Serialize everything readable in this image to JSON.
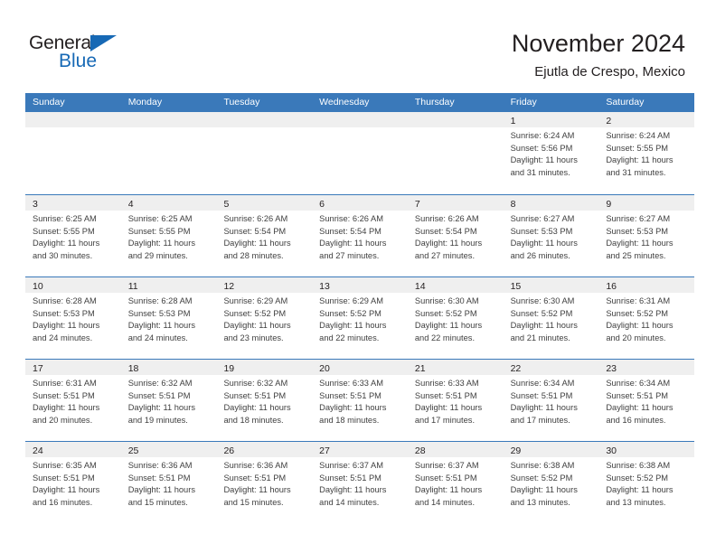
{
  "brand": {
    "word_one": "General",
    "word_two": "Blue",
    "accent_color": "#1769b5",
    "triangle_icon": "triangle-icon"
  },
  "header": {
    "title": "November 2024",
    "subtitle": "Ejutla de Crespo, Mexico"
  },
  "theme": {
    "header_blue": "#3a79ba",
    "daynum_band": "#efefef",
    "text": "#231f20",
    "body_text": "#3f3f3f"
  },
  "weekday_headers": [
    "Sunday",
    "Monday",
    "Tuesday",
    "Wednesday",
    "Thursday",
    "Friday",
    "Saturday"
  ],
  "weeks": [
    [
      {
        "day": "",
        "lines": []
      },
      {
        "day": "",
        "lines": []
      },
      {
        "day": "",
        "lines": []
      },
      {
        "day": "",
        "lines": []
      },
      {
        "day": "",
        "lines": []
      },
      {
        "day": "1",
        "lines": [
          "Sunrise: 6:24 AM",
          "Sunset: 5:56 PM",
          "Daylight: 11 hours",
          "and 31 minutes."
        ]
      },
      {
        "day": "2",
        "lines": [
          "Sunrise: 6:24 AM",
          "Sunset: 5:55 PM",
          "Daylight: 11 hours",
          "and 31 minutes."
        ]
      }
    ],
    [
      {
        "day": "3",
        "lines": [
          "Sunrise: 6:25 AM",
          "Sunset: 5:55 PM",
          "Daylight: 11 hours",
          "and 30 minutes."
        ]
      },
      {
        "day": "4",
        "lines": [
          "Sunrise: 6:25 AM",
          "Sunset: 5:55 PM",
          "Daylight: 11 hours",
          "and 29 minutes."
        ]
      },
      {
        "day": "5",
        "lines": [
          "Sunrise: 6:26 AM",
          "Sunset: 5:54 PM",
          "Daylight: 11 hours",
          "and 28 minutes."
        ]
      },
      {
        "day": "6",
        "lines": [
          "Sunrise: 6:26 AM",
          "Sunset: 5:54 PM",
          "Daylight: 11 hours",
          "and 27 minutes."
        ]
      },
      {
        "day": "7",
        "lines": [
          "Sunrise: 6:26 AM",
          "Sunset: 5:54 PM",
          "Daylight: 11 hours",
          "and 27 minutes."
        ]
      },
      {
        "day": "8",
        "lines": [
          "Sunrise: 6:27 AM",
          "Sunset: 5:53 PM",
          "Daylight: 11 hours",
          "and 26 minutes."
        ]
      },
      {
        "day": "9",
        "lines": [
          "Sunrise: 6:27 AM",
          "Sunset: 5:53 PM",
          "Daylight: 11 hours",
          "and 25 minutes."
        ]
      }
    ],
    [
      {
        "day": "10",
        "lines": [
          "Sunrise: 6:28 AM",
          "Sunset: 5:53 PM",
          "Daylight: 11 hours",
          "and 24 minutes."
        ]
      },
      {
        "day": "11",
        "lines": [
          "Sunrise: 6:28 AM",
          "Sunset: 5:53 PM",
          "Daylight: 11 hours",
          "and 24 minutes."
        ]
      },
      {
        "day": "12",
        "lines": [
          "Sunrise: 6:29 AM",
          "Sunset: 5:52 PM",
          "Daylight: 11 hours",
          "and 23 minutes."
        ]
      },
      {
        "day": "13",
        "lines": [
          "Sunrise: 6:29 AM",
          "Sunset: 5:52 PM",
          "Daylight: 11 hours",
          "and 22 minutes."
        ]
      },
      {
        "day": "14",
        "lines": [
          "Sunrise: 6:30 AM",
          "Sunset: 5:52 PM",
          "Daylight: 11 hours",
          "and 22 minutes."
        ]
      },
      {
        "day": "15",
        "lines": [
          "Sunrise: 6:30 AM",
          "Sunset: 5:52 PM",
          "Daylight: 11 hours",
          "and 21 minutes."
        ]
      },
      {
        "day": "16",
        "lines": [
          "Sunrise: 6:31 AM",
          "Sunset: 5:52 PM",
          "Daylight: 11 hours",
          "and 20 minutes."
        ]
      }
    ],
    [
      {
        "day": "17",
        "lines": [
          "Sunrise: 6:31 AM",
          "Sunset: 5:51 PM",
          "Daylight: 11 hours",
          "and 20 minutes."
        ]
      },
      {
        "day": "18",
        "lines": [
          "Sunrise: 6:32 AM",
          "Sunset: 5:51 PM",
          "Daylight: 11 hours",
          "and 19 minutes."
        ]
      },
      {
        "day": "19",
        "lines": [
          "Sunrise: 6:32 AM",
          "Sunset: 5:51 PM",
          "Daylight: 11 hours",
          "and 18 minutes."
        ]
      },
      {
        "day": "20",
        "lines": [
          "Sunrise: 6:33 AM",
          "Sunset: 5:51 PM",
          "Daylight: 11 hours",
          "and 18 minutes."
        ]
      },
      {
        "day": "21",
        "lines": [
          "Sunrise: 6:33 AM",
          "Sunset: 5:51 PM",
          "Daylight: 11 hours",
          "and 17 minutes."
        ]
      },
      {
        "day": "22",
        "lines": [
          "Sunrise: 6:34 AM",
          "Sunset: 5:51 PM",
          "Daylight: 11 hours",
          "and 17 minutes."
        ]
      },
      {
        "day": "23",
        "lines": [
          "Sunrise: 6:34 AM",
          "Sunset: 5:51 PM",
          "Daylight: 11 hours",
          "and 16 minutes."
        ]
      }
    ],
    [
      {
        "day": "24",
        "lines": [
          "Sunrise: 6:35 AM",
          "Sunset: 5:51 PM",
          "Daylight: 11 hours",
          "and 16 minutes."
        ]
      },
      {
        "day": "25",
        "lines": [
          "Sunrise: 6:36 AM",
          "Sunset: 5:51 PM",
          "Daylight: 11 hours",
          "and 15 minutes."
        ]
      },
      {
        "day": "26",
        "lines": [
          "Sunrise: 6:36 AM",
          "Sunset: 5:51 PM",
          "Daylight: 11 hours",
          "and 15 minutes."
        ]
      },
      {
        "day": "27",
        "lines": [
          "Sunrise: 6:37 AM",
          "Sunset: 5:51 PM",
          "Daylight: 11 hours",
          "and 14 minutes."
        ]
      },
      {
        "day": "28",
        "lines": [
          "Sunrise: 6:37 AM",
          "Sunset: 5:51 PM",
          "Daylight: 11 hours",
          "and 14 minutes."
        ]
      },
      {
        "day": "29",
        "lines": [
          "Sunrise: 6:38 AM",
          "Sunset: 5:52 PM",
          "Daylight: 11 hours",
          "and 13 minutes."
        ]
      },
      {
        "day": "30",
        "lines": [
          "Sunrise: 6:38 AM",
          "Sunset: 5:52 PM",
          "Daylight: 11 hours",
          "and 13 minutes."
        ]
      }
    ]
  ]
}
